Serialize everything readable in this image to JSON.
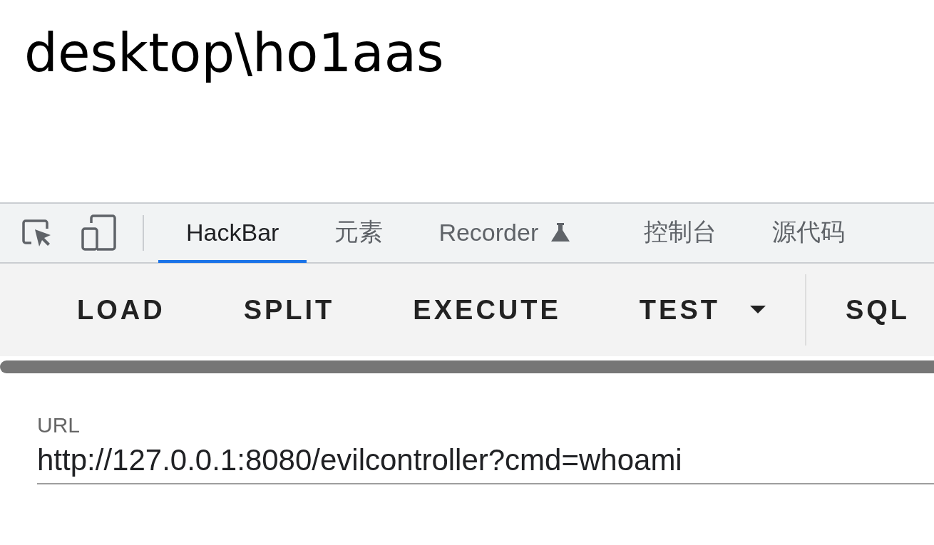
{
  "page": {
    "heading": "desktop\\ho1aas"
  },
  "devtools": {
    "tabs": [
      {
        "label": "HackBar",
        "selected": true,
        "kind": "plain"
      },
      {
        "label": "元素",
        "selected": false,
        "kind": "plain"
      },
      {
        "label": "Recorder",
        "selected": false,
        "kind": "experimental"
      },
      {
        "label": "控制台",
        "selected": false,
        "kind": "plain"
      },
      {
        "label": "源代码",
        "selected": false,
        "kind": "plain"
      }
    ]
  },
  "hackbar": {
    "buttons": [
      {
        "label": "LOAD",
        "kind": "plain"
      },
      {
        "label": "SPLIT",
        "kind": "plain"
      },
      {
        "label": "EXECUTE",
        "kind": "plain"
      },
      {
        "label": "TEST",
        "kind": "dropdown"
      }
    ],
    "more_buttons": [
      {
        "label": "SQL"
      }
    ],
    "url_field": {
      "label": "URL",
      "value": "http://127.0.0.1:8080/evilcontroller?cmd=whoami"
    }
  }
}
